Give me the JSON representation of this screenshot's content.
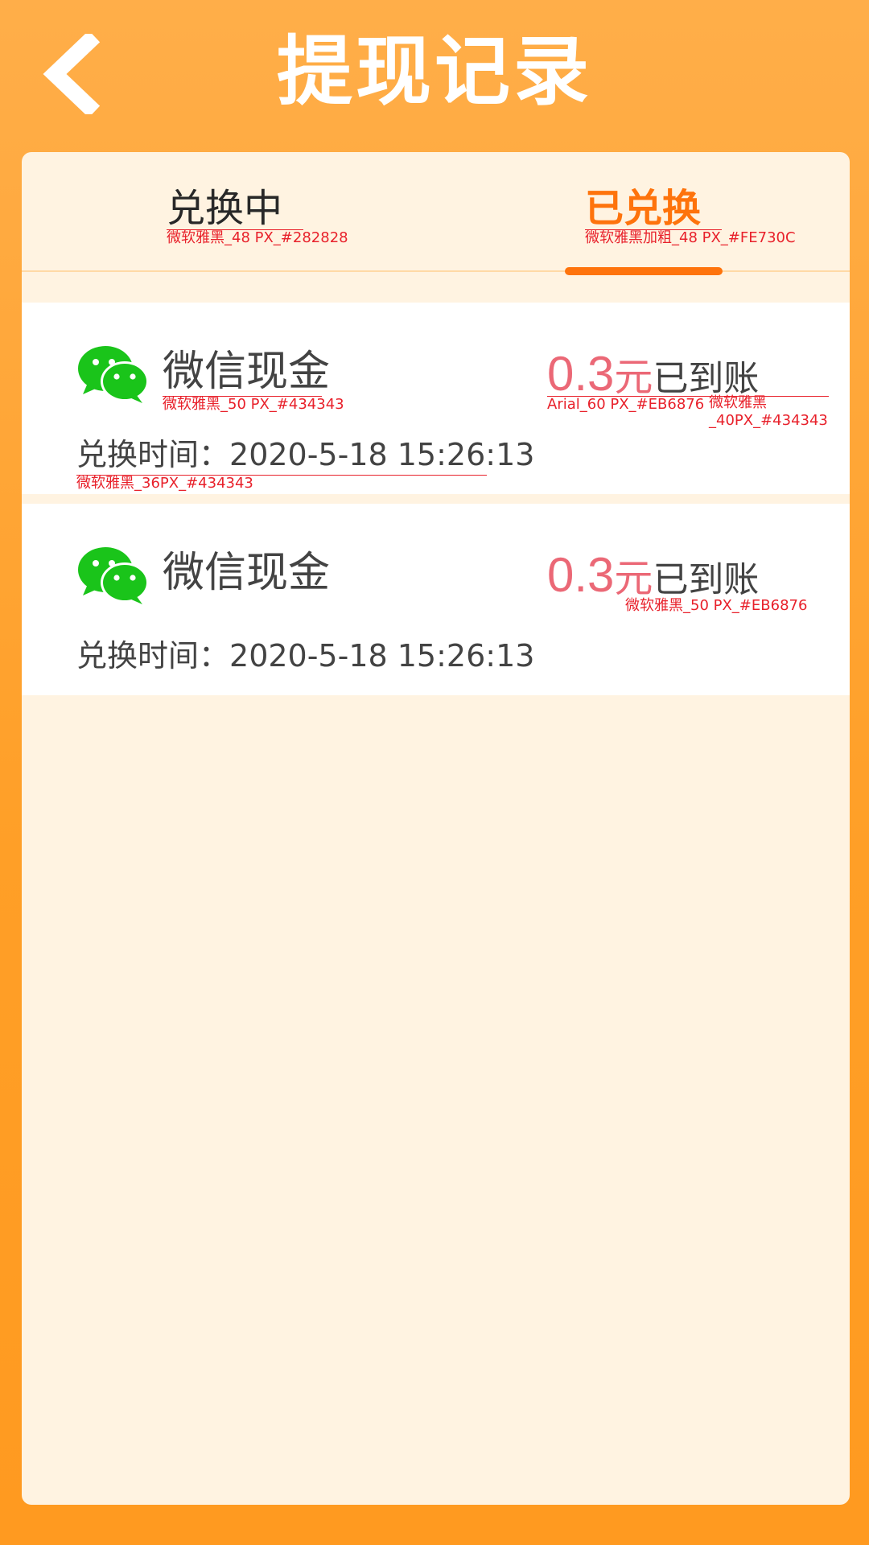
{
  "header": {
    "title": "提现记录"
  },
  "tabs": [
    {
      "label": "兑换中",
      "note": "微软雅黑_48 PX_#282828"
    },
    {
      "label": "已兑换",
      "note": "微软雅黑加粗_48 PX_#FE730C"
    }
  ],
  "records": [
    {
      "title": "微信现金",
      "amount": "0.3",
      "unit": "元",
      "status": "已到账",
      "time_label": "兑换时间：",
      "time_value": "2020-5-18 15:26:13",
      "notes": {
        "title": "微软雅黑_50 PX_#434343",
        "amount": "Arial_60 PX_#EB6876",
        "status_line1": "微软雅黑",
        "status_line2": "_40PX_#434343",
        "time": "微软雅黑_36PX_#434343"
      }
    },
    {
      "title": "微信现金",
      "amount": "0.3",
      "unit": "元",
      "status": "已到账",
      "time_label": "兑换时间：",
      "time_value": "2020-5-18 15:26:13",
      "notes": {
        "unit": "微软雅黑_50 PX_#EB6876"
      }
    }
  ],
  "colors": {
    "header_bg": "#FFA73B",
    "panel_bg": "#FFF3E1",
    "active_tab": "#FE730C",
    "amount": "#EB6876",
    "text_dark": "#434343",
    "wechat_green": "#1AC41A"
  },
  "icons": {
    "back": "chevron-left-icon",
    "wechat": "wechat-icon"
  }
}
